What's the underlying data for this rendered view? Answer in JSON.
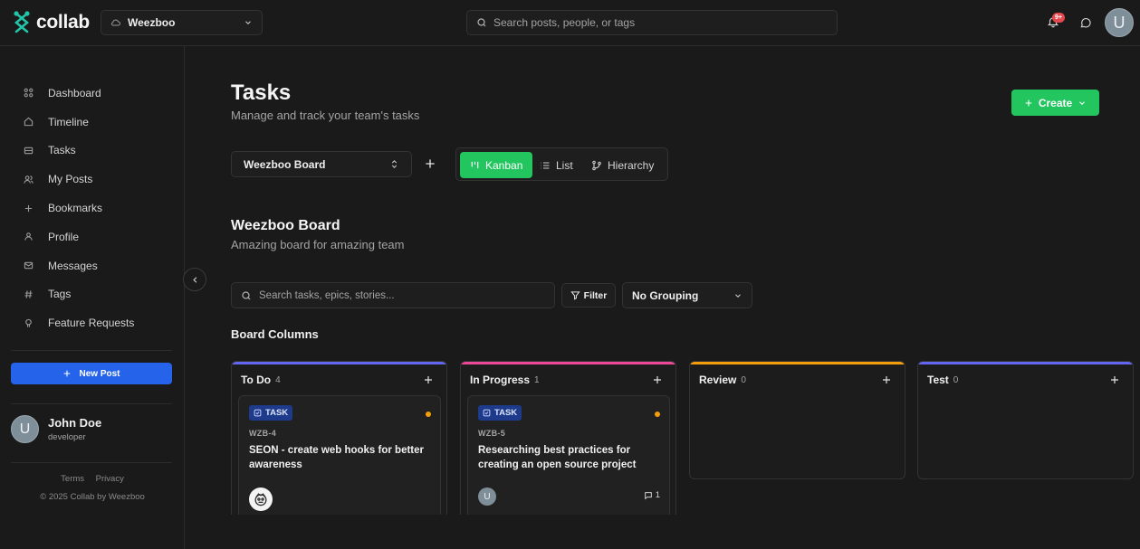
{
  "app": {
    "logo_text": "collab",
    "brand_color": "#22c55e"
  },
  "header": {
    "workspace": "Weezboo",
    "search_placeholder": "Search posts, people, or tags",
    "notification_badge": "9+",
    "avatar_initial": "U"
  },
  "sidebar": {
    "items": [
      {
        "label": "Dashboard",
        "icon": "grid-icon"
      },
      {
        "label": "Timeline",
        "icon": "home-icon"
      },
      {
        "label": "Tasks",
        "icon": "inbox-icon"
      },
      {
        "label": "My Posts",
        "icon": "users-icon"
      },
      {
        "label": "Bookmarks",
        "icon": "plus-icon"
      },
      {
        "label": "Profile",
        "icon": "user-icon"
      },
      {
        "label": "Messages",
        "icon": "mail-icon"
      },
      {
        "label": "Tags",
        "icon": "hash-icon"
      },
      {
        "label": "Feature Requests",
        "icon": "lightbulb-icon"
      }
    ],
    "new_post_label": "New Post",
    "user": {
      "initial": "U",
      "name": "John Doe",
      "role": "developer"
    },
    "footer": {
      "terms": "Terms",
      "privacy": "Privacy",
      "copyright": "© 2025 Collab by Weezboo"
    }
  },
  "main": {
    "title": "Tasks",
    "subtitle": "Manage and track your team's tasks",
    "create_label": "Create",
    "board_select": "Weezboo Board",
    "views": {
      "kanban": "Kanban",
      "list": "List",
      "hierarchy": "Hierarchy",
      "active": "Kanban"
    },
    "board_title": "Weezboo Board",
    "board_subtitle": "Amazing board for amazing team",
    "task_search_placeholder": "Search tasks, epics, stories...",
    "filter_label": "Filter",
    "grouping": "No Grouping",
    "columns_title": "Board Columns",
    "columns": [
      {
        "name": "To Do",
        "count": "4",
        "color": "#6366f1",
        "card": {
          "type": "TASK",
          "key": "WZB-4",
          "title": "SEON - create web hooks for better awareness",
          "priority_color": "#f59e0b"
        }
      },
      {
        "name": "In Progress",
        "count": "1",
        "color": "#ec4899",
        "card": {
          "type": "TASK",
          "key": "WZB-5",
          "title": "Researching best practices for creating an open source project",
          "priority_color": "#f59e0b",
          "assignee_initial": "U",
          "comments": "1"
        }
      },
      {
        "name": "Review",
        "count": "0",
        "color": "#f59e0b"
      },
      {
        "name": "Test",
        "count": "0",
        "color": "#6366f1"
      }
    ]
  }
}
